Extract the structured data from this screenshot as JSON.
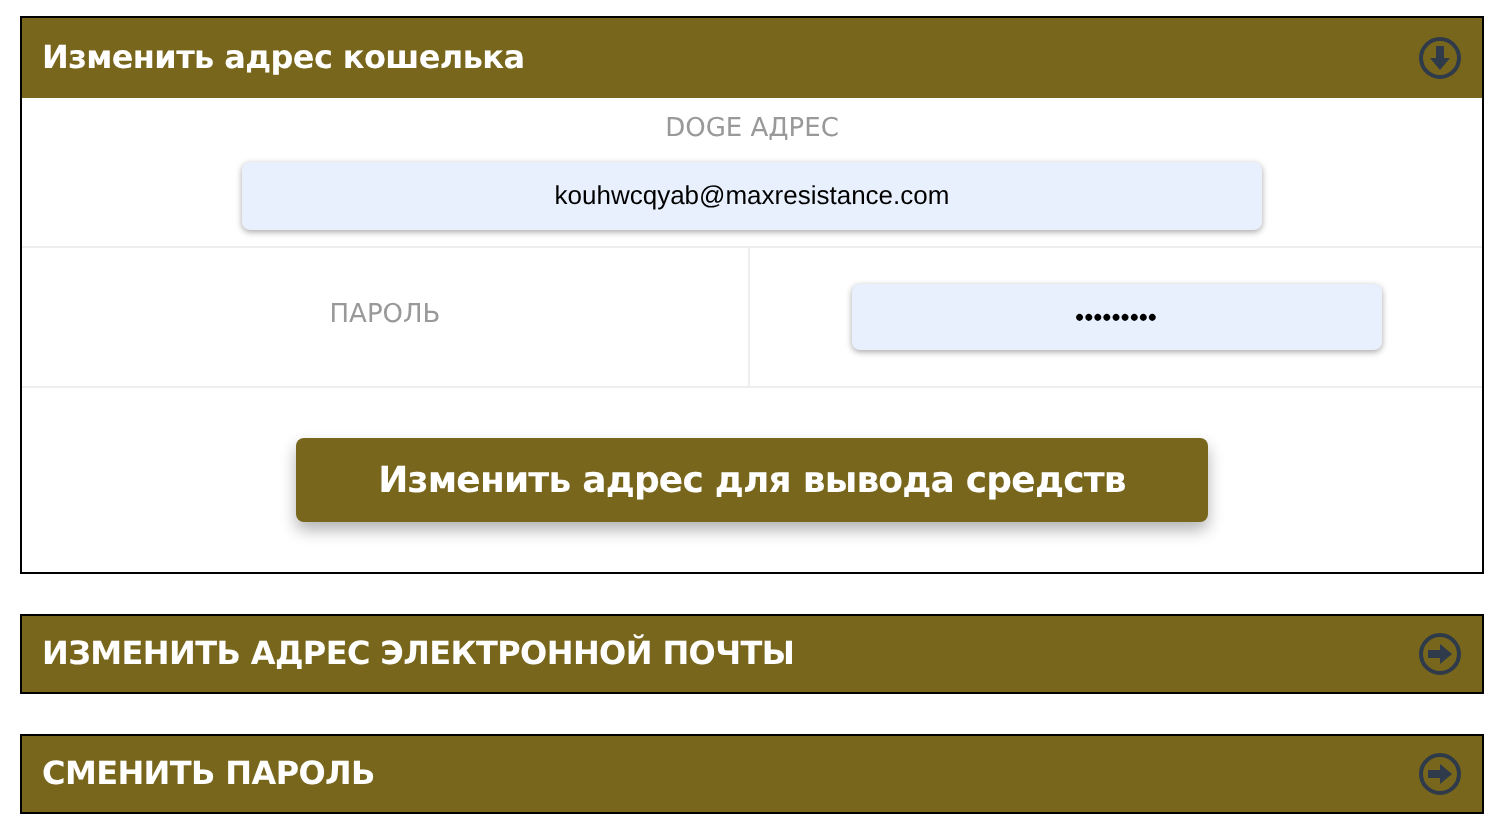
{
  "sections": [
    {
      "title": "Изменить адрес кошелька",
      "expanded": true,
      "address_label": "DOGE АДРЕС",
      "address_value": "kouhwcqyab@maxresistance.com",
      "password_label": "ПАРОЛЬ",
      "password_value": "•••••••••",
      "submit": "Изменить адрес для вывода средств"
    },
    {
      "title": "ИЗМЕНИТЬ АДРЕС ЭЛЕКТРОННОЙ ПОЧТЫ",
      "expanded": false
    },
    {
      "title": "СМЕНИТЬ ПАРОЛЬ",
      "expanded": false
    }
  ]
}
